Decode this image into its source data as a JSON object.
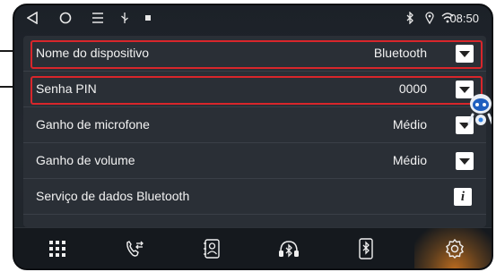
{
  "status_bar": {
    "left_icons": [
      "back-triangle-icon",
      "home-circle-icon",
      "menu-lines-icon",
      "usb-icon",
      "notification-dot-icon"
    ],
    "right_icons": [
      "bluetooth-icon",
      "location-icon",
      "wifi-icon"
    ],
    "time": "08:50"
  },
  "settings": {
    "rows": [
      {
        "label": "Nome do dispositivo",
        "value": "Bluetooth",
        "control": "dropdown"
      },
      {
        "label": "Senha PIN",
        "value": "0000",
        "control": "dropdown"
      },
      {
        "label": "Ganho de microfone",
        "value": "Médio",
        "control": "dropdown"
      },
      {
        "label": "Ganho de volume",
        "value": "Médio",
        "control": "dropdown"
      },
      {
        "label": "Serviço de dados Bluetooth",
        "value": "",
        "control": "info"
      }
    ]
  },
  "bottom_nav": {
    "items": [
      {
        "icon": "app-grid-icon"
      },
      {
        "icon": "phone-calls-icon"
      },
      {
        "icon": "contacts-icon"
      },
      {
        "icon": "bluetooth-audio-icon"
      },
      {
        "icon": "bluetooth-phone-icon"
      },
      {
        "icon": "settings-gear-icon",
        "active": true
      }
    ]
  },
  "colors": {
    "highlight": "#d8262b",
    "panel": "#2a2f36",
    "background": "#1c2128",
    "active_nav": "#b86a1f"
  }
}
